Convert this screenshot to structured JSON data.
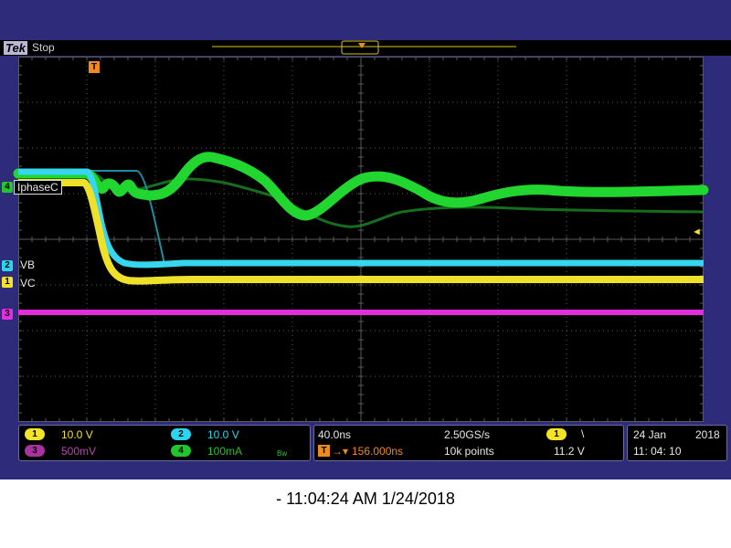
{
  "header": {
    "brand": "Tek",
    "acq_state": "Stop"
  },
  "channels": {
    "ch1": {
      "number": "1",
      "label": "VC",
      "scale": "10.0 V",
      "color": "#f4e425"
    },
    "ch2": {
      "number": "2",
      "label": "VB",
      "scale": "10.0 V",
      "color": "#2ad6ef"
    },
    "ch3": {
      "number": "3",
      "label": "",
      "scale": "500mV",
      "color": "#e22de0"
    },
    "ch4": {
      "number": "4",
      "label": "IphaseC",
      "scale": "100mA",
      "bw_mark": "Bw",
      "color": "#22c52a"
    }
  },
  "trigger_marker": "T",
  "trigger_level_marker": "◄",
  "timebase": {
    "time_per_div": "40.0ns",
    "sample_rate": "2.50GS/s",
    "position": "156.000ns",
    "record_length": "10k points",
    "trig_source": "1",
    "trig_slope": "\\",
    "trig_level": "11.2 V"
  },
  "date": {
    "day_month": "24 Jan",
    "year": "2018",
    "time": "11: 04: 10"
  },
  "caption": "- 11:04:24 AM    1/24/2018",
  "colors": {
    "bezel": "#2e2b7a",
    "graticule": "#5a5a5a",
    "orange": "#f08a1c"
  }
}
